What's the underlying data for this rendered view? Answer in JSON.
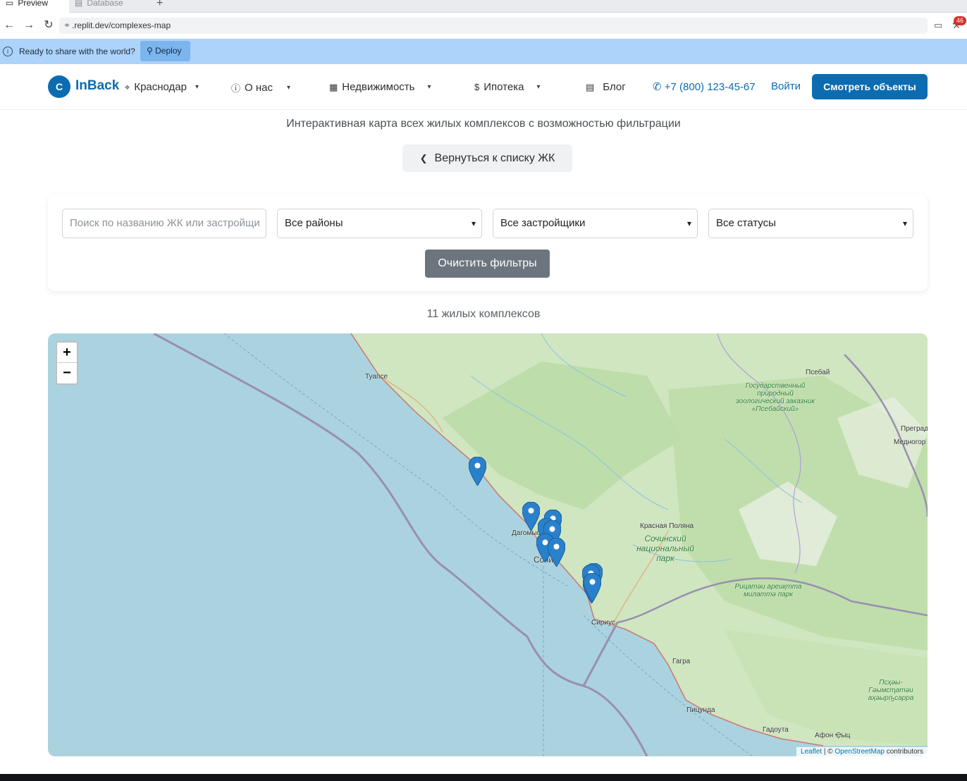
{
  "browser": {
    "tabs": [
      {
        "label": "Preview",
        "icon": "monitor-icon",
        "active": true
      },
      {
        "label": "Database",
        "icon": "database-icon",
        "active": false
      }
    ],
    "url": ".replit.dev/complexes-map",
    "notif_count": "46",
    "info_text": "Ready to share with the world?",
    "deploy_label": "Deploy"
  },
  "header": {
    "logo_letter": "C",
    "logo_text": "InBack",
    "city": "Краснодар",
    "nav": {
      "about": "О нас",
      "realty": "Недвижимость",
      "mortgage": "Ипотека",
      "blog": "Блог"
    },
    "phone": "+7 (800) 123-45-67",
    "login": "Войти",
    "cta": "Смотреть объекты",
    "brand_color": "#0b6cb1"
  },
  "main": {
    "subtitle": "Интерактивная карта всех жилых комплексов с возможностью фильтрации",
    "back_label": "Вернуться к списку ЖК",
    "filters": {
      "search_placeholder": "Поиск по названию ЖК или застройщи",
      "district": "Все районы",
      "developer": "Все застройщики",
      "status": "Все статусы",
      "clear_label": "Очистить фильтры"
    },
    "count_text": "11 жилых комплексов"
  },
  "map": {
    "zoom_in": "+",
    "zoom_out": "−",
    "attribution": {
      "leaflet": "Leaflet",
      "sep": " | © ",
      "osm": "OpenStreetMap",
      "suffix": " contributors"
    },
    "labels": {
      "tuapse": "Туапсе",
      "psebay": "Псебай",
      "preg": "Преград",
      "medn": "Медногор",
      "dagomys": "Дагомыс",
      "sochi": "Сочи",
      "krasnaya": "Красная Поляна",
      "sirius": "Сириус",
      "gagra": "Гагра",
      "pitsunda": "Пицунда",
      "gudauta": "Гадоута",
      "afon": "Афон Ҿыц"
    },
    "park_labels": {
      "psebay_reserve": "Государственный природный зоологический заказник «Псебайский»",
      "sochi_park": "Сочинский национальный парк",
      "ritsa": "Рицатәи ареиқтта милаттә парк",
      "pskhu": "Псҳәы-Гәымсҭатәи аҳәырҧсарра"
    }
  }
}
